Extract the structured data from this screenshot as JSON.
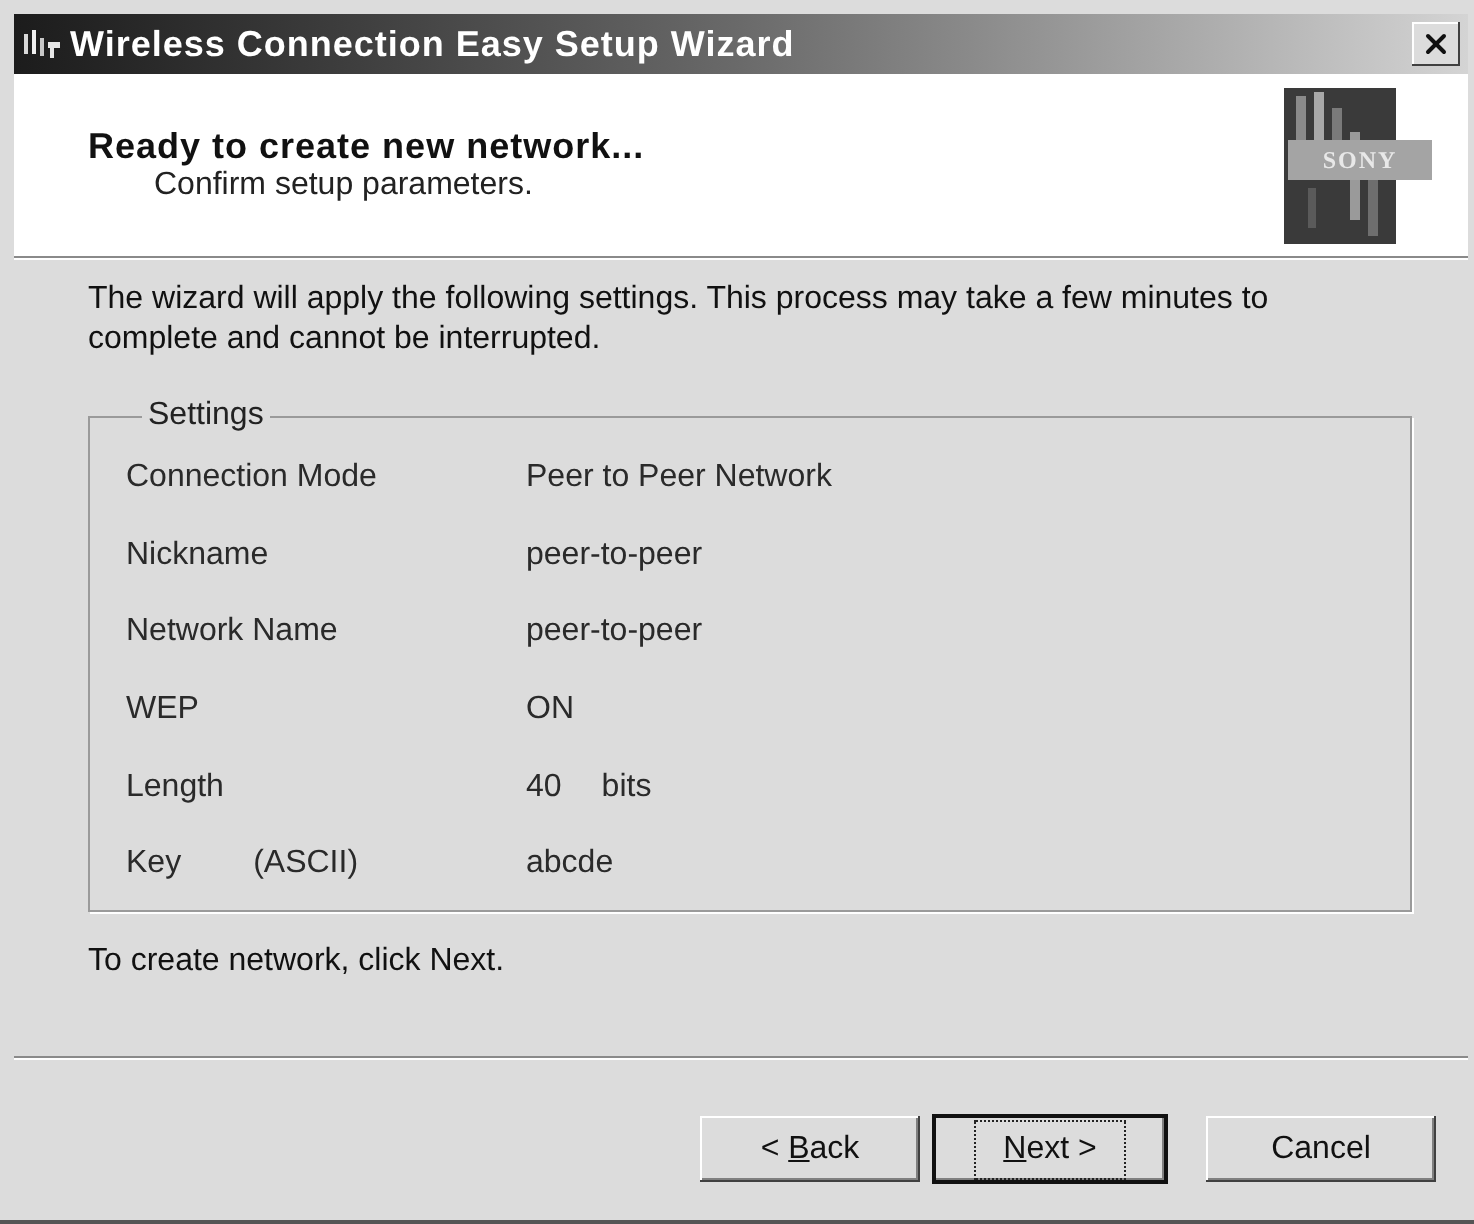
{
  "window": {
    "title": "Wireless Connection Easy Setup Wizard"
  },
  "header": {
    "title": "Ready to create new network...",
    "subtitle": "Confirm setup parameters.",
    "logo": {
      "text": "SONY"
    }
  },
  "intro": "The wizard will apply the following settings. This process may take a few minutes to complete and cannot be interrupted.",
  "settings": {
    "title": "Settings",
    "rows": [
      {
        "label": "Connection Mode",
        "value": "Peer to Peer Network"
      },
      {
        "label": "Nickname",
        "value": "peer-to-peer"
      },
      {
        "label": "Network Name",
        "value": "peer-to-peer"
      },
      {
        "label": "WEP",
        "value": "ON"
      },
      {
        "label": "Length",
        "value": "40",
        "unit": "bits"
      },
      {
        "label": "Key",
        "qualifier": "(ASCII)",
        "value": "abcde"
      }
    ]
  },
  "hint": "To create network, click Next.",
  "buttons": [
    {
      "before": "< ",
      "access_key": "B",
      "after": "ack",
      "focused": false
    },
    {
      "access_key": "N",
      "after": "ext >",
      "focused": true
    },
    {
      "label": "Cancel",
      "focused": false
    }
  ]
}
